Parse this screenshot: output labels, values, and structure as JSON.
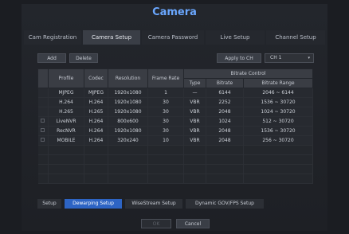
{
  "window": {
    "title": "Camera"
  },
  "tabs": [
    {
      "label": "Cam Registration",
      "active": false
    },
    {
      "label": "Camera Setup",
      "active": true
    },
    {
      "label": "Camera Password",
      "active": false
    },
    {
      "label": "Live Setup",
      "active": false
    },
    {
      "label": "Channel Setup",
      "active": false
    }
  ],
  "toolbar": {
    "add_label": "Add",
    "delete_label": "Delete",
    "apply_label": "Apply to CH",
    "channel_value": "CH 1"
  },
  "table": {
    "headers": {
      "profile": "Profile",
      "codec": "Codec",
      "resolution": "Resolution",
      "frame_rate": "Frame Rate",
      "bitrate_control": "Bitrate Control",
      "type": "Type",
      "bitrate": "Bitrate",
      "bitrate_range": "Bitrate Range"
    },
    "rows": [
      {
        "profile": "MJPEG",
        "codec": "MJPEG",
        "resolution": "1920x1080",
        "frame_rate": "1",
        "type": "—",
        "bitrate": "6144",
        "bitrate_range": "2046 ~ 6144"
      },
      {
        "profile": "H.264",
        "codec": "H.264",
        "resolution": "1920x1080",
        "frame_rate": "30",
        "type": "VBR",
        "bitrate": "2252",
        "bitrate_range": "1536 ~ 30720"
      },
      {
        "profile": "H.265",
        "codec": "H.265",
        "resolution": "1920x1080",
        "frame_rate": "30",
        "type": "VBR",
        "bitrate": "2048",
        "bitrate_range": "1024 ~ 30720"
      },
      {
        "profile": "LiveNVR",
        "codec": "H.264",
        "resolution": "800x600",
        "frame_rate": "30",
        "type": "VBR",
        "bitrate": "1024",
        "bitrate_range": "512 ~ 30720"
      },
      {
        "profile": "RecNVR",
        "codec": "H.264",
        "resolution": "1920x1080",
        "frame_rate": "30",
        "type": "VBR",
        "bitrate": "2048",
        "bitrate_range": "1536 ~ 30720"
      },
      {
        "profile": "MOBILE",
        "codec": "H.264",
        "resolution": "320x240",
        "frame_rate": "10",
        "type": "VBR",
        "bitrate": "2048",
        "bitrate_range": "256 ~ 30720"
      }
    ]
  },
  "bottom_tabs": [
    {
      "label": "Setup",
      "active": false
    },
    {
      "label": "Dewarping Setup",
      "active": true
    },
    {
      "label": "WiseStream Setup",
      "active": false
    },
    {
      "label": "Dynamic GOV/FPS Setup",
      "active": false
    }
  ],
  "footer": {
    "ok_label": "OK",
    "cancel_label": "Cancel"
  }
}
